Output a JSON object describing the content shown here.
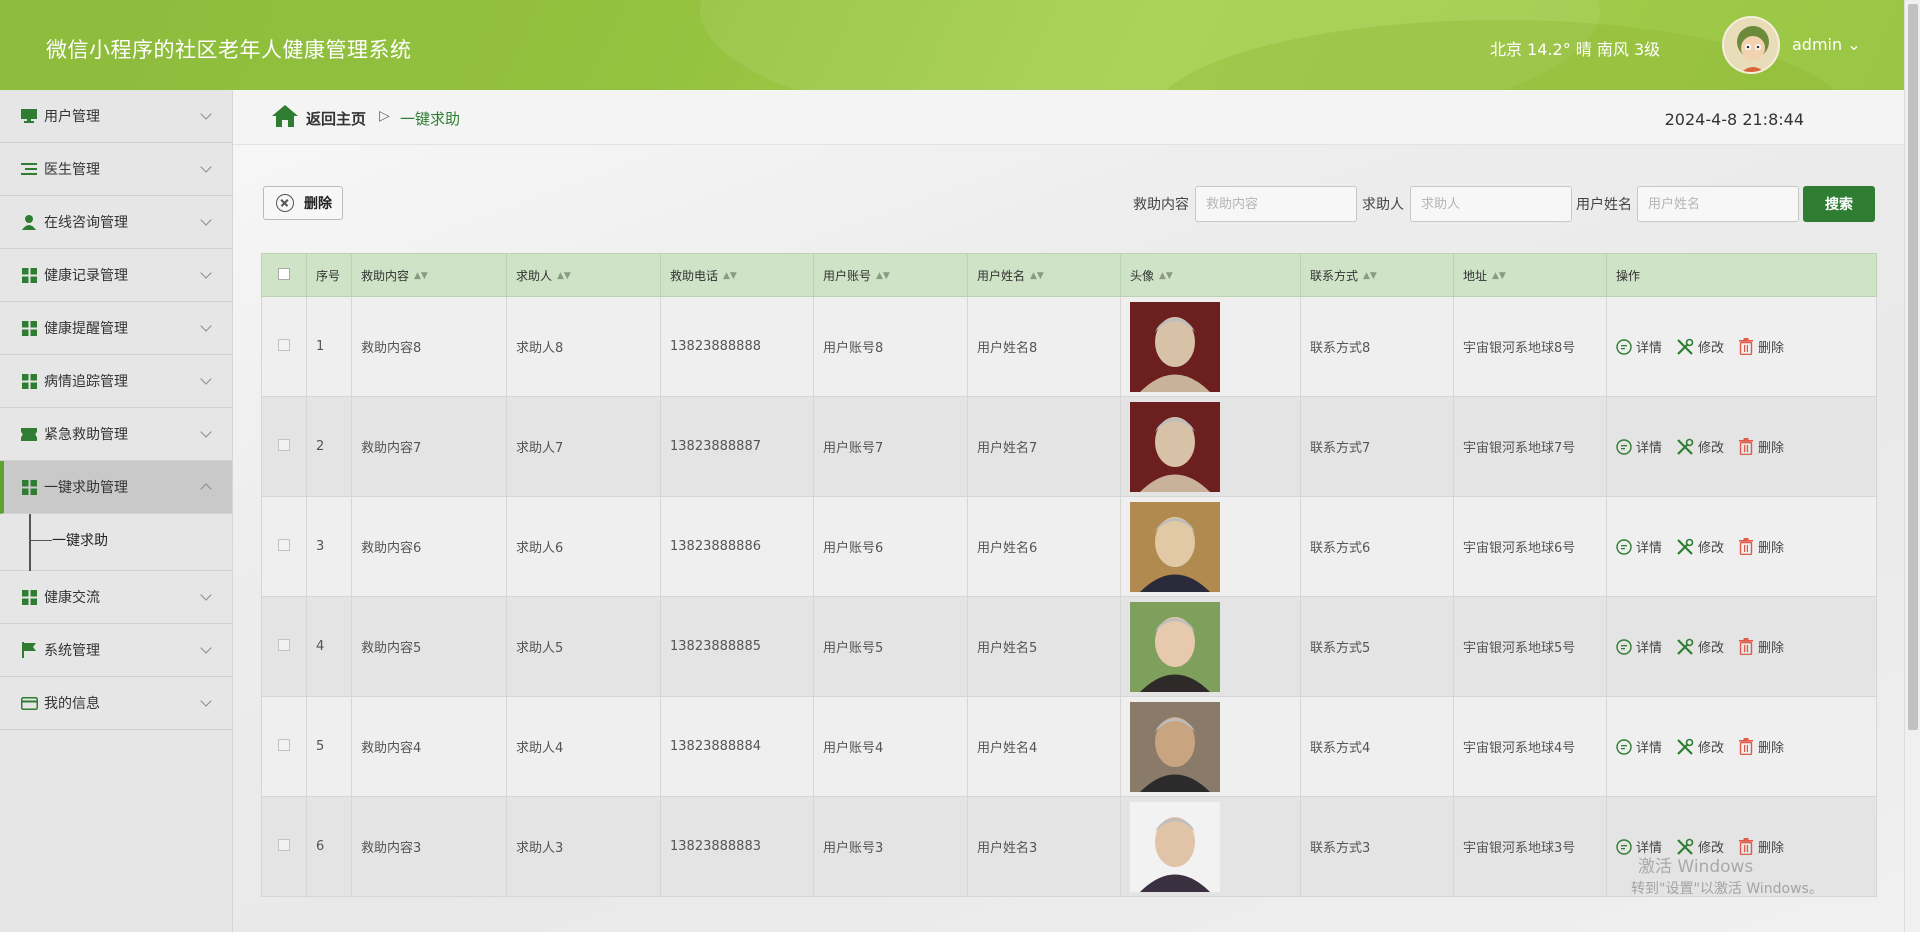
{
  "header": {
    "title": "微信小程序的社区老年人健康管理系统",
    "weather": "北京  14.2°  晴  南风  3级",
    "user": "admin ⌄"
  },
  "sidebar": {
    "items": [
      {
        "label": "用户管理",
        "icon": "monitor-icon"
      },
      {
        "label": "医生管理",
        "icon": "list-icon"
      },
      {
        "label": "在线咨询管理",
        "icon": "person-icon"
      },
      {
        "label": "健康记录管理",
        "icon": "grid-icon"
      },
      {
        "label": "健康提醒管理",
        "icon": "grid-icon"
      },
      {
        "label": "病情追踪管理",
        "icon": "grid-icon"
      },
      {
        "label": "紧急救助管理",
        "icon": "ticket-icon"
      },
      {
        "label": "一键求助管理",
        "icon": "grid-icon"
      },
      {
        "label": "健康交流",
        "icon": "grid-icon"
      },
      {
        "label": "系统管理",
        "icon": "flag-icon"
      },
      {
        "label": "我的信息",
        "icon": "card-icon"
      }
    ],
    "subitem": "一键求助"
  },
  "breadcrumb": {
    "home": "返回主页",
    "sep": "▷",
    "current": "一键求助",
    "time": "2024-4-8 21:8:44"
  },
  "toolbar": {
    "delete": "删除",
    "search": [
      {
        "label": "救助内容",
        "placeholder": "救助内容"
      },
      {
        "label": "求助人",
        "placeholder": "求助人"
      },
      {
        "label": "用户姓名",
        "placeholder": "用户姓名"
      }
    ],
    "search_button": "搜索"
  },
  "table": {
    "headers": [
      "序号",
      "救助内容",
      "求助人",
      "救助电话",
      "用户账号",
      "用户姓名",
      "头像",
      "联系方式",
      "地址",
      "操作"
    ],
    "rows": [
      {
        "no": "1",
        "content": "救助内容8",
        "helper": "求助人8",
        "phone": "13823888888",
        "account": "用户账号8",
        "name": "用户姓名8",
        "contact": "联系方式8",
        "address": "宇宙银河系地球8号"
      },
      {
        "no": "2",
        "content": "救助内容7",
        "helper": "求助人7",
        "phone": "13823888887",
        "account": "用户账号7",
        "name": "用户姓名7",
        "contact": "联系方式7",
        "address": "宇宙银河系地球7号"
      },
      {
        "no": "3",
        "content": "救助内容6",
        "helper": "求助人6",
        "phone": "13823888886",
        "account": "用户账号6",
        "name": "用户姓名6",
        "contact": "联系方式6",
        "address": "宇宙银河系地球6号"
      },
      {
        "no": "4",
        "content": "救助内容5",
        "helper": "求助人5",
        "phone": "13823888885",
        "account": "用户账号5",
        "name": "用户姓名5",
        "contact": "联系方式5",
        "address": "宇宙银河系地球5号"
      },
      {
        "no": "5",
        "content": "救助内容4",
        "helper": "求助人4",
        "phone": "13823888884",
        "account": "用户账号4",
        "name": "用户姓名4",
        "contact": "联系方式4",
        "address": "宇宙银河系地球4号"
      },
      {
        "no": "6",
        "content": "救助内容3",
        "helper": "求助人3",
        "phone": "13823888883",
        "account": "用户账号3",
        "name": "用户姓名3",
        "contact": "联系方式3",
        "address": "宇宙银河系地球3号"
      }
    ],
    "ops": {
      "detail": "详情",
      "edit": "修改",
      "delete": "删除"
    }
  },
  "watermark": {
    "line1": "激活 Windows",
    "line2": "转到\"设置\"以激活 Windows。"
  },
  "colors": {
    "header": "#93c23f",
    "accent": "#2e7d32",
    "table_header": "#cfe3c6",
    "delete_red": "#e05a4a"
  }
}
